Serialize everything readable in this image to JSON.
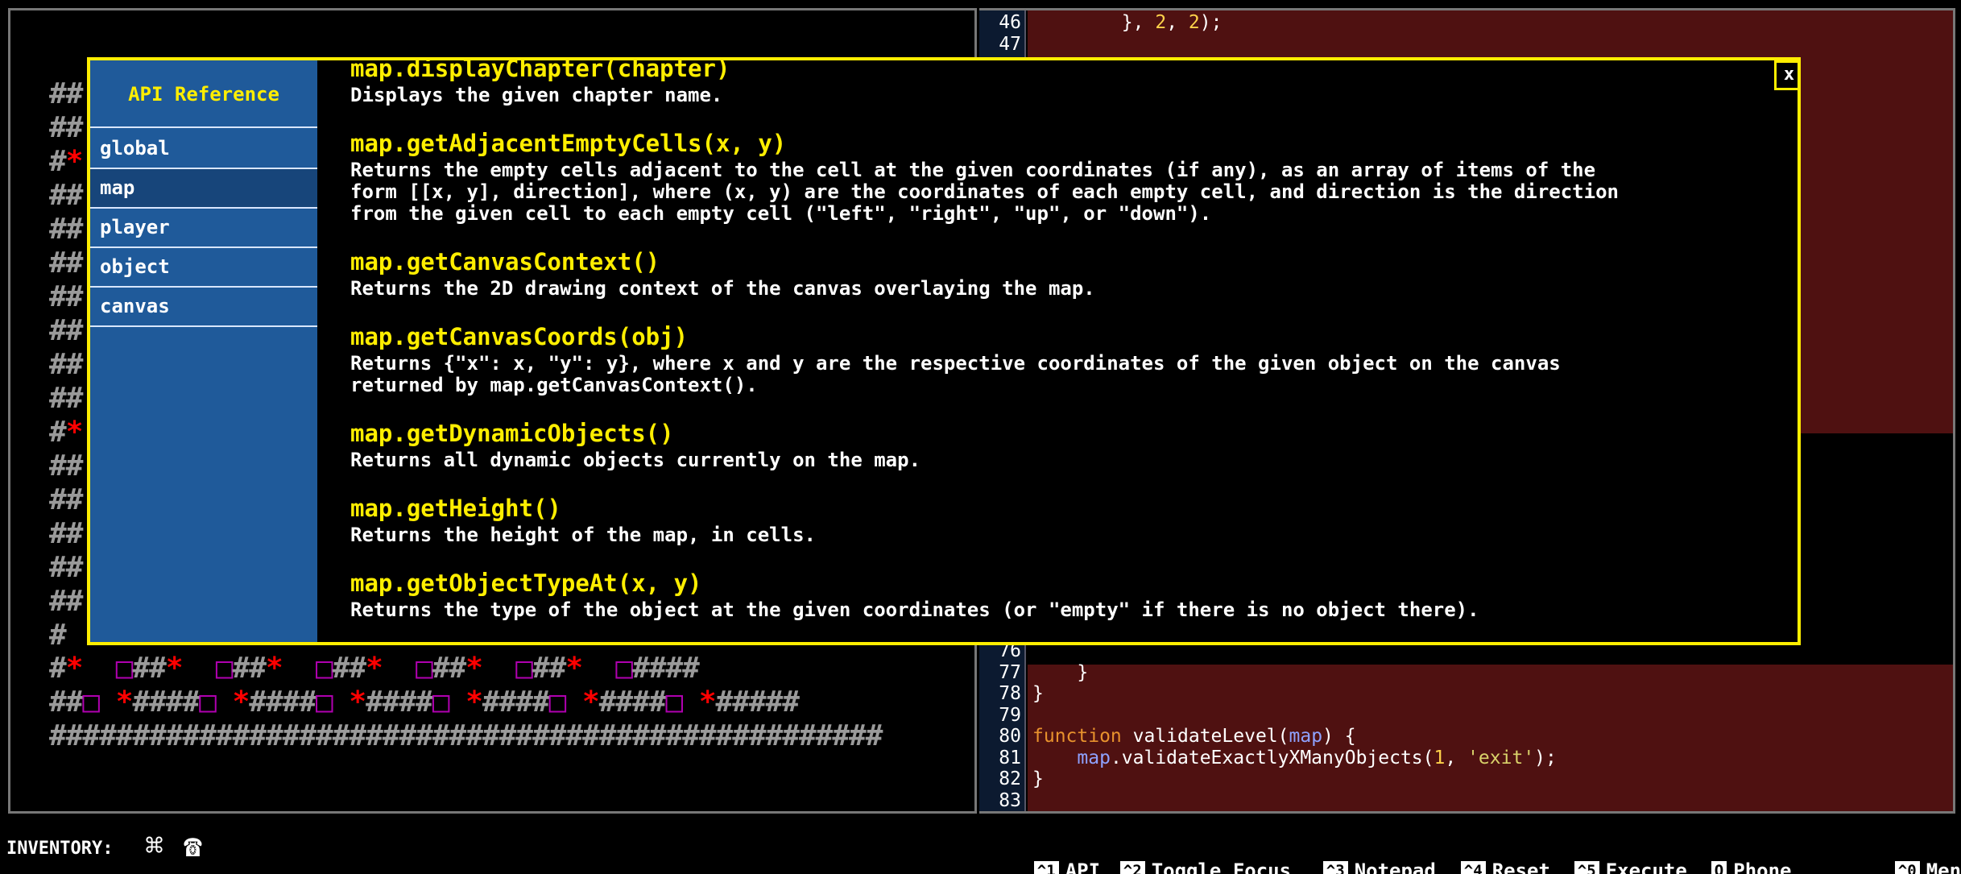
{
  "map": {
    "rows": [
      "##                                               ####",
      "##",
      "#*",
      "##",
      "##",
      "##",
      "##",
      "##",
      "##",
      "##",
      "#*",
      "##",
      "##",
      "##",
      "##",
      "##",
      "#",
      "#*  □##*  □##*  □##*  □##*  □##*  □####",
      "##□ *####□ *####□ *####□ *####□ *####□ *#####",
      "##################################################"
    ]
  },
  "editor": {
    "top_lines": [
      {
        "num": "46",
        "code": "        }, 2, 2);"
      },
      {
        "num": "47",
        "code": ""
      }
    ],
    "bottom_lines": [
      {
        "num": "76",
        "code": ""
      },
      {
        "num": "77",
        "code": "    }"
      },
      {
        "num": "78",
        "code": "}"
      },
      {
        "num": "79",
        "code": ""
      },
      {
        "num": "80",
        "code": "function validateLevel(map) {"
      },
      {
        "num": "81",
        "code": "    map.validateExactlyXManyObjects(1, 'exit');"
      },
      {
        "num": "82",
        "code": "}"
      },
      {
        "num": "83",
        "code": ""
      }
    ]
  },
  "api": {
    "title": "API Reference",
    "tabs": [
      "global",
      "map",
      "player",
      "object",
      "canvas"
    ],
    "active_tab": "map",
    "close_label": "x",
    "entries": [
      {
        "signature": "map.displayChapter(chapter)",
        "description": [
          "Displays the given chapter name."
        ]
      },
      {
        "signature": "map.getAdjacentEmptyCells(x, y)",
        "description": [
          "Returns the empty cells adjacent to the cell at the given coordinates (if any), as an array of items of the",
          "form [[x, y], direction], where (x, y) are the coordinates of each empty cell, and direction is the direction",
          "from the given cell to each empty cell (\"left\", \"right\", \"up\", or \"down\")."
        ]
      },
      {
        "signature": "map.getCanvasContext()",
        "description": [
          "Returns the 2D drawing context of the canvas overlaying the map."
        ]
      },
      {
        "signature": "map.getCanvasCoords(obj)",
        "description": [
          "Returns {\"x\": x, \"y\": y}, where x and y are the respective coordinates of the given object on the canvas",
          "returned by map.getCanvasContext()."
        ]
      },
      {
        "signature": "map.getDynamicObjects()",
        "description": [
          "Returns all dynamic objects currently on the map."
        ]
      },
      {
        "signature": "map.getHeight()",
        "description": [
          "Returns the height of the map, in cells."
        ]
      },
      {
        "signature": "map.getObjectTypeAt(x, y)",
        "description": [
          "Returns the type of the object at the given coordinates (or \"empty\" if there is no object there)."
        ]
      }
    ]
  },
  "bottom": {
    "inventory_label": "INVENTORY:",
    "inventory_icons": [
      "⌘",
      "☎"
    ],
    "hotkeys": [
      {
        "key": "^1",
        "label": "API"
      },
      {
        "key": "^2",
        "label": "Toggle Focus"
      },
      {
        "key": "^3",
        "label": "Notepad"
      },
      {
        "key": "^4",
        "label": "Reset"
      },
      {
        "key": "^5",
        "label": "Execute"
      },
      {
        "key": "Q",
        "label": "Phone"
      },
      {
        "key": "^0",
        "label": "Menu"
      }
    ]
  },
  "colors": {
    "accent": "#ffee00",
    "sidebar": "#1f5a9a",
    "locked_code_bg": "#4f1111"
  }
}
